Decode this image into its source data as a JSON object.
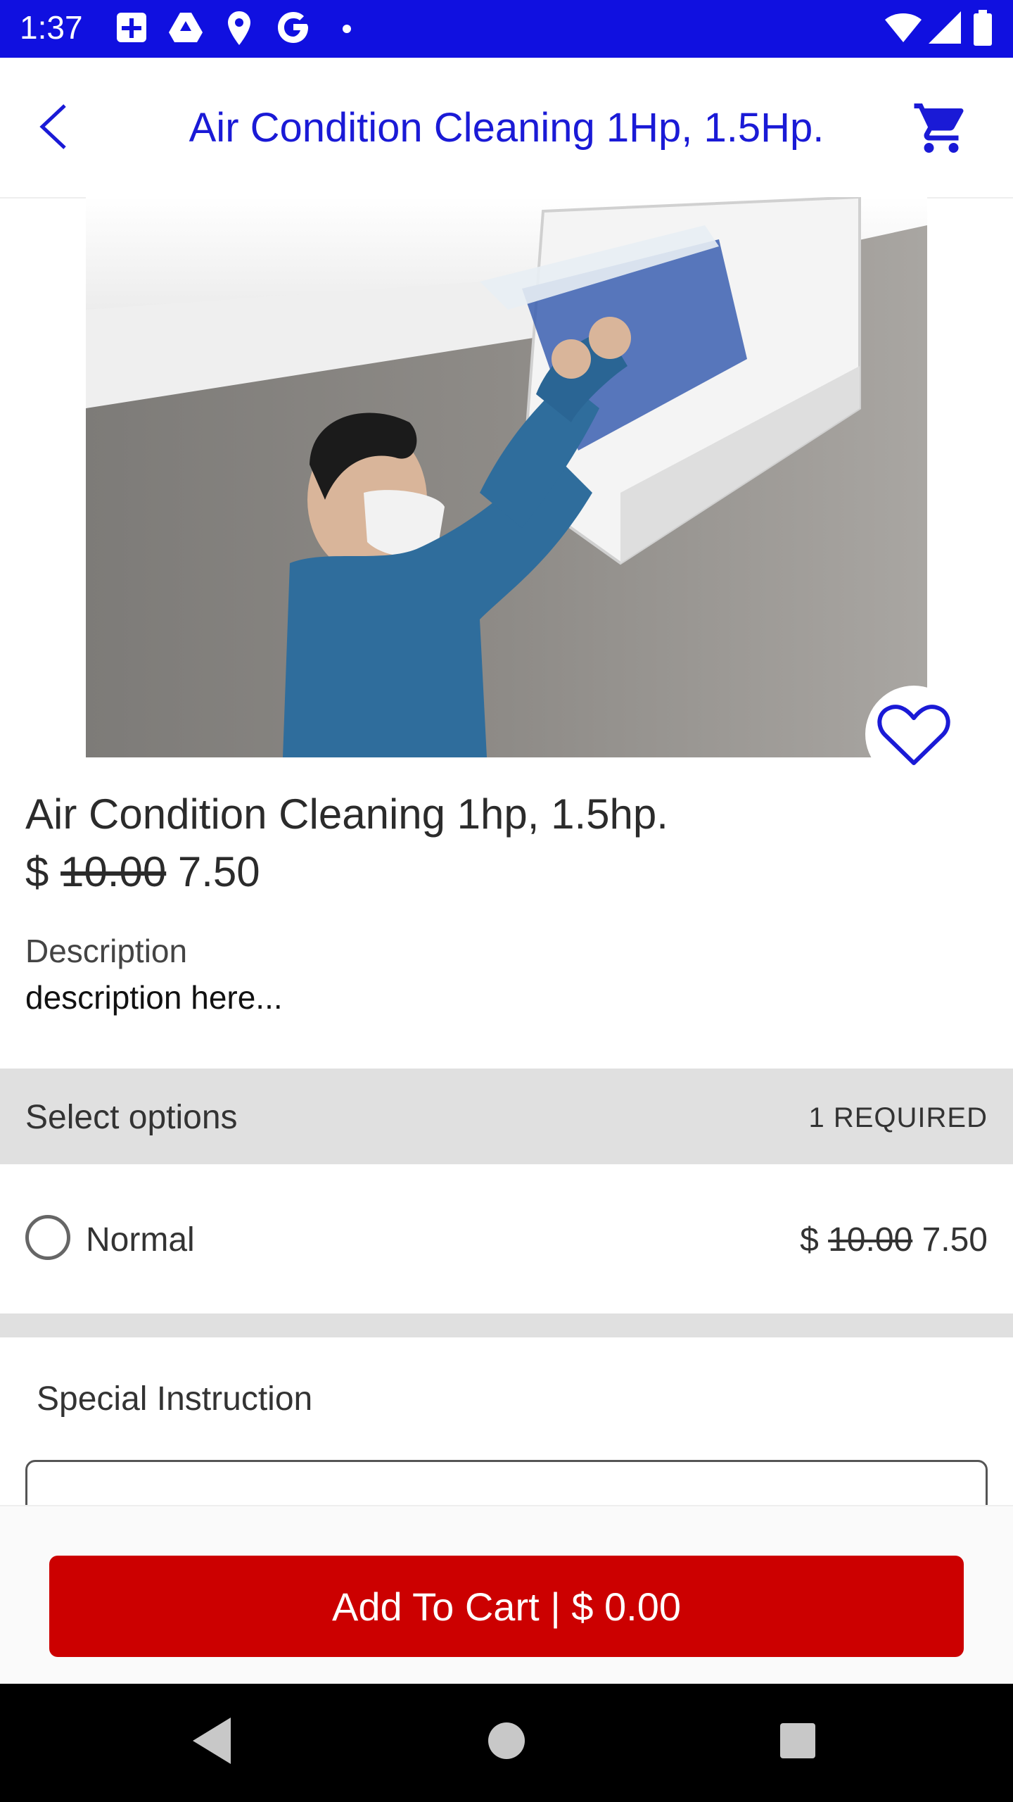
{
  "status_bar": {
    "time": "1:37"
  },
  "header": {
    "title": "Air Condition Cleaning 1Hp, 1.5Hp."
  },
  "product": {
    "name": "Air Condition Cleaning 1hp, 1.5hp.",
    "currency": "$",
    "old_price": "10.00",
    "price": "7.50",
    "description_label": "Description",
    "description": "description here..."
  },
  "options": {
    "title": "Select options",
    "required": "1 REQUIRED",
    "items": [
      {
        "label": "Normal",
        "currency": "$",
        "old_price": "10.00",
        "price": "7.50",
        "selected": false
      }
    ]
  },
  "special_instruction": {
    "label": "Special Instruction",
    "value": ""
  },
  "cart_button": {
    "label": "Add To Cart | $ 0.00"
  },
  "icons": {
    "back": "chevron-left-icon",
    "cart": "shopping-cart-icon",
    "favorite": "heart-outline-icon"
  },
  "colors": {
    "status_bar": "#1010e0",
    "title": "#1a1ad6",
    "accent_button": "#cc0000",
    "section_band": "#e0e0e0"
  }
}
